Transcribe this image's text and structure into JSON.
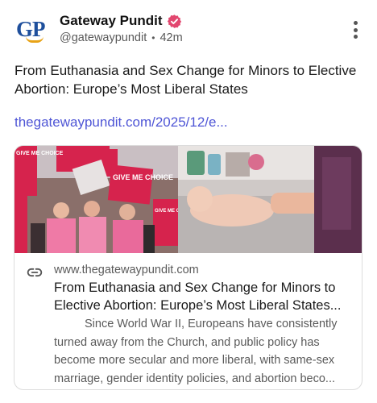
{
  "post": {
    "author_name": "Gateway Pundit",
    "handle": "@gatewaypundit",
    "separator": "•",
    "time": "42m",
    "avatar_text": "GP",
    "text": "From Euthanasia and Sex Change for Minors to Elective Abortion: Europe’s Most Liberal States",
    "link_text": "thegatewaypundit.com/2025/12/e..."
  },
  "card": {
    "domain": "www.thegatewaypundit.com",
    "title": "From Euthanasia and Sex Change for Minors to Elective Abortion: Europe’s Most Liberal States...",
    "description": "Since World War II, Europeans have consistently turned away from the Church, and public policy has become more secular and more liberal, with same-sex marriage, gender identity policies, and abortion beco...",
    "image_signs": [
      "GIVE ME CHOICE",
      "GIVE ME CHOICE",
      "GIVE ME CHOICE",
      "GIVE ME CHOICE"
    ]
  },
  "icons": {
    "verified": "verified-badge-icon",
    "more": "more-vertical-icon",
    "link": "link-icon"
  },
  "colors": {
    "link": "#4f56d6",
    "verified": "#e2476f",
    "avatar_text": "#1e4f9c",
    "avatar_arc": "#e8a317"
  }
}
